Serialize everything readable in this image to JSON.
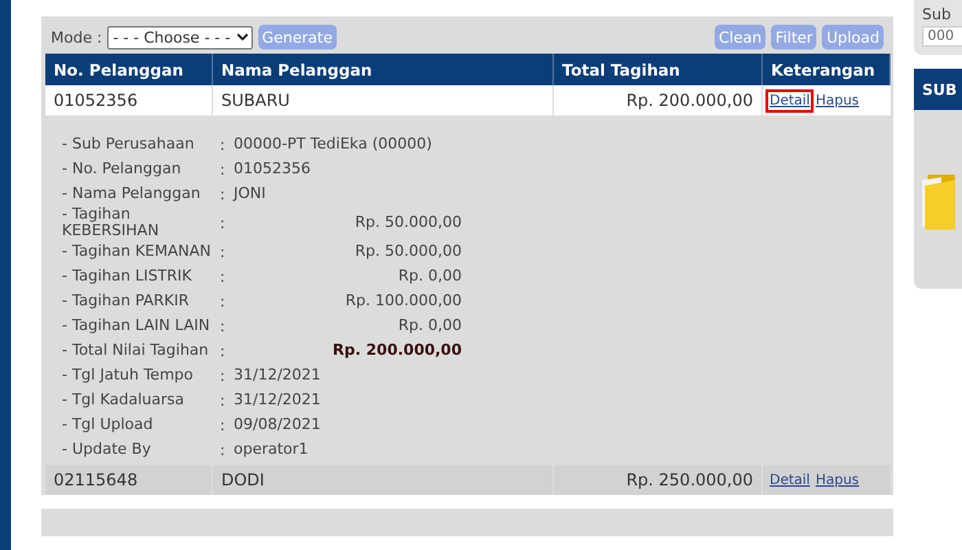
{
  "toolbar": {
    "mode_label": "Mode :",
    "mode_select": "- - - Choose - - -",
    "left_buttons": [
      "Generate"
    ],
    "right_buttons": [
      "Clean",
      "Filter",
      "Upload"
    ]
  },
  "table": {
    "columns": [
      "No. Pelanggan",
      "Nama Pelanggan",
      "Total Tagihan",
      "Keterangan"
    ],
    "rows": [
      {
        "no": "01052356",
        "nama": "SUBARU",
        "total": "Rp. 200.000,00",
        "expanded": true,
        "actions": [
          {
            "label": "Detail",
            "highlighted": true
          },
          {
            "label": "Hapus",
            "highlighted": false
          }
        ],
        "details": [
          {
            "label": "- Sub Perusahaan",
            "separator": ":",
            "kind": "text",
            "value": "00000-PT TediEka (00000)"
          },
          {
            "label": "- No. Pelanggan",
            "separator": ":",
            "kind": "text",
            "value": "01052356"
          },
          {
            "label": "- Nama Pelanggan",
            "separator": ":",
            "kind": "text",
            "value": "JONI"
          },
          {
            "label": "- Tagihan KEBERSIHAN",
            "separator": ":",
            "kind": "amount",
            "value": "Rp. 50.000,00"
          },
          {
            "label": "- Tagihan KEMANAN",
            "separator": ":",
            "kind": "amount",
            "value": "Rp. 50.000,00"
          },
          {
            "label": "- Tagihan LISTRIK",
            "separator": ":",
            "kind": "amount",
            "value": "Rp. 0,00"
          },
          {
            "label": "- Tagihan PARKIR",
            "separator": ":",
            "kind": "amount",
            "value": "Rp. 100.000,00"
          },
          {
            "label": "- Tagihan LAIN LAIN",
            "separator": ":",
            "kind": "amount",
            "value": "Rp. 0,00"
          },
          {
            "label": "- Total Nilai Tagihan",
            "separator": ":",
            "kind": "total",
            "value": "Rp. 200.000,00"
          },
          {
            "label": "- Tgl Jatuh Tempo",
            "separator": ":",
            "kind": "text",
            "value": "31/12/2021"
          },
          {
            "label": "- Tgl Kadaluarsa",
            "separator": ":",
            "kind": "text",
            "value": "31/12/2021"
          },
          {
            "label": "- Tgl Upload",
            "separator": ":",
            "kind": "text",
            "value": "09/08/2021"
          },
          {
            "label": "- Update By",
            "separator": ":",
            "kind": "text",
            "value": "operator1"
          }
        ]
      },
      {
        "no": "02115648",
        "nama": "DODI",
        "total": "Rp. 250.000,00",
        "expanded": false,
        "actions": [
          {
            "label": "Detail",
            "highlighted": false
          },
          {
            "label": "Hapus",
            "highlighted": false
          }
        ],
        "details": []
      }
    ]
  },
  "side_panel": {
    "field_label": "Sub",
    "field_value": "000",
    "header": "SUB"
  }
}
